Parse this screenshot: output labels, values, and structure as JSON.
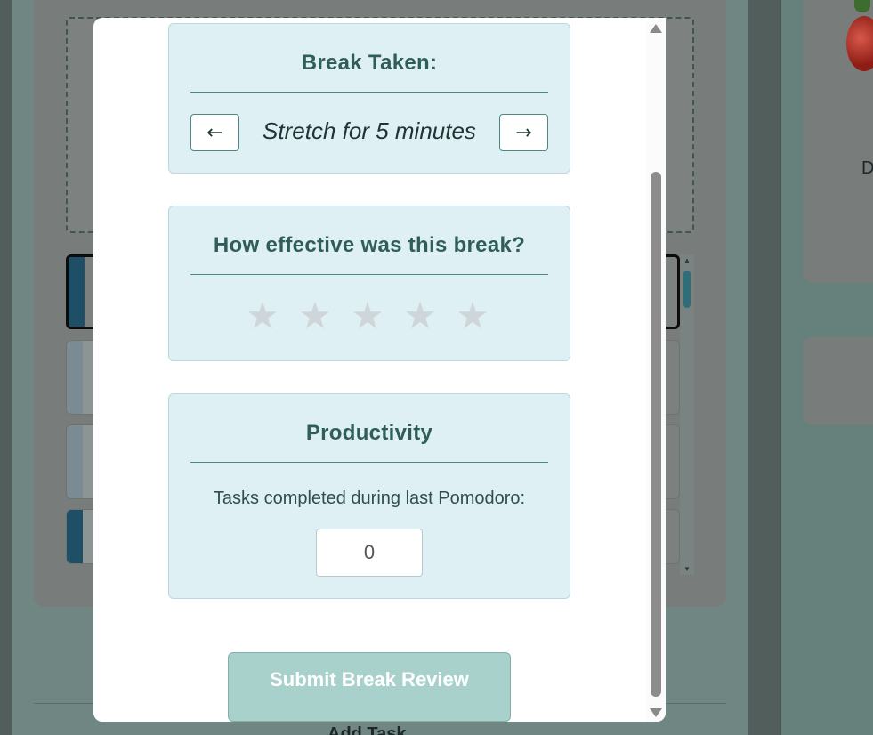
{
  "background": {
    "add_task_label": "Add Task",
    "right_panel_text": "D"
  },
  "modal": {
    "break_section": {
      "title": "Break Taken:",
      "current_break": "Stretch for 5 minutes",
      "prev_label": "←",
      "next_label": "→"
    },
    "rating_section": {
      "title": "How effective was this break?",
      "star_glyph": "★",
      "max_stars": 5,
      "rating": 0
    },
    "productivity_section": {
      "title": "Productivity",
      "tasks_label": "Tasks completed during last Pomodoro:",
      "tasks_completed": "0"
    },
    "submit_label": "Submit Break Review"
  },
  "colors": {
    "section_bg": "#dff0f5",
    "heading": "#2f5e58",
    "submit_bg": "#a9d1cc",
    "star_inactive": "#cfd6da"
  }
}
